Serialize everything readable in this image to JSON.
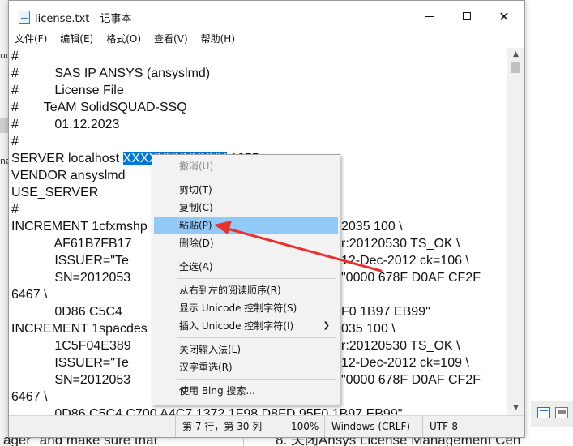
{
  "window": {
    "title": "license.txt - 记事本",
    "controls": {
      "minimize": "—",
      "maximize": "☐",
      "close": "✕"
    }
  },
  "menu": [
    "文件(F)",
    "编辑(E)",
    "格式(O)",
    "查看(V)",
    "帮助(H)"
  ],
  "editor": {
    "lines": [
      "#",
      "#          SAS IP ANSYS (ansyslmd)",
      "#          License File",
      "#       TeAM SolidSQUAD-SSQ",
      "#          01.12.2023",
      "#",
      "SERVER localhost ",
      "VENDOR ansyslmd",
      "USE_SERVER",
      "#",
      "INCREMENT 1cfxmshp",
      "            AF61B7FB17",
      "            ISSUER=\"Te",
      "            SN=2012053",
      "6467 \\",
      "            0D86 C5C4",
      "INCREMENT 1spacdes",
      "            1C5F04E389",
      "            ISSUER=\"Te",
      "            SN=2012053",
      "6467 \\",
      "            0D86 C5C4 C700 A4C7 1372 1F98 D8FD 95F0 1B97 EB99\""
    ],
    "server_selected": "XXXXXXXXXXXX",
    "server_tail": " 1055",
    "right_fragments": [
      {
        "line": 10,
        "text": "2035 100 \\"
      },
      {
        "line": 11,
        "text": "r:20120530 TS_OK \\"
      },
      {
        "line": 12,
        "text": "12-Dec-2012 ck=106 \\"
      },
      {
        "line": 13,
        "text": "\"0000 678F D0AF CF2F"
      },
      {
        "line": 15,
        "text": "F0 1B97 EB99\""
      },
      {
        "line": 16,
        "text": "035 100 \\"
      },
      {
        "line": 17,
        "text": "r:20120530 TS_OK \\"
      },
      {
        "line": 18,
        "text": "12-Dec-2012 ck=109 \\"
      },
      {
        "line": 19,
        "text": "\"0000 678F D0AF CF2F"
      }
    ]
  },
  "status": {
    "position": "第 7 行，第 30 列",
    "zoom": "100%",
    "line_ending": "Windows (CRLF)",
    "encoding": "UTF-8"
  },
  "context_menu": [
    {
      "label": "撤消(U)",
      "disabled": true
    },
    {
      "label": "剪切(T)"
    },
    {
      "label": "复制(C)"
    },
    {
      "label": "粘贴(P)",
      "highlighted": true
    },
    {
      "label": "删除(D)"
    },
    {
      "label": "全选(A)"
    },
    {
      "label": "从右到左的阅读顺序(R)"
    },
    {
      "label": "显示 Unicode 控制字符(S)"
    },
    {
      "label": "插入 Unicode 控制字符(I)",
      "submenu": true
    },
    {
      "label": "关闭输入法(L)"
    },
    {
      "label": "汉字重选(R)"
    },
    {
      "label": "使用 Bing 搜索..."
    }
  ],
  "background": {
    "left_fragments": [
      "uc",
      "na"
    ],
    "bottom_left": "ager\" and make sure that",
    "bottom_right": "8. 关闭Ansys License Management Cen"
  },
  "colors": {
    "selection": "#0078d7",
    "menu_highlight": "#91c9f7",
    "annotation": "#e8322f"
  }
}
